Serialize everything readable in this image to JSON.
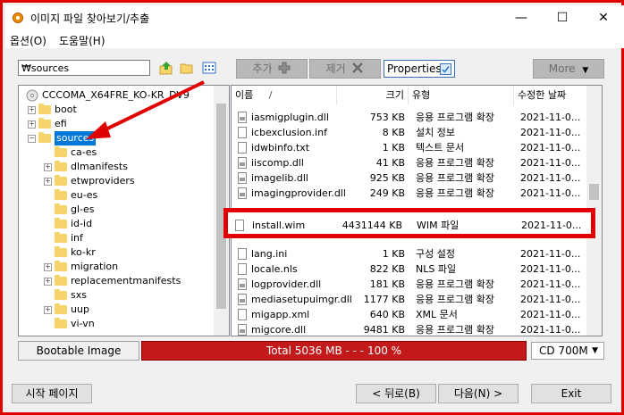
{
  "window": {
    "title": "이미지 파일 찾아보기/추출",
    "controls": {
      "minimize": "—",
      "maximize": "☐",
      "close": "✕"
    }
  },
  "menu": [
    "옵션(O)",
    "도움말(H)"
  ],
  "toolbar": {
    "path": "₩sources",
    "add_label": "추가",
    "remove_label": "제거",
    "properties_label": "Properties",
    "more_label": "More"
  },
  "tree": {
    "root": "CCCOMA_X64FRE_KO-KR_DV9",
    "items": [
      {
        "label": "boot",
        "expandable": true,
        "selected": false
      },
      {
        "label": "efi",
        "expandable": true,
        "selected": false
      },
      {
        "label": "sources",
        "expandable": true,
        "selected": true,
        "expanded": true
      }
    ],
    "children": [
      {
        "label": "ca-es",
        "expandable": false
      },
      {
        "label": "dlmanifests",
        "expandable": true
      },
      {
        "label": "etwproviders",
        "expandable": true
      },
      {
        "label": "eu-es",
        "expandable": false
      },
      {
        "label": "gl-es",
        "expandable": false
      },
      {
        "label": "id-id",
        "expandable": false
      },
      {
        "label": "inf",
        "expandable": false
      },
      {
        "label": "ko-kr",
        "expandable": false
      },
      {
        "label": "migration",
        "expandable": true
      },
      {
        "label": "replacementmanifests",
        "expandable": true
      },
      {
        "label": "sxs",
        "expandable": false
      },
      {
        "label": "uup",
        "expandable": true
      },
      {
        "label": "vi-vn",
        "expandable": false
      }
    ]
  },
  "list": {
    "columns": {
      "name": "이름",
      "sort_marker": "/",
      "size": "크기",
      "type": "유형",
      "date": "수정한 날짜"
    },
    "rows_before": [
      {
        "name": "iasmigplugin.dll",
        "size": "753 KB",
        "type": "응용 프로그램 확장",
        "date": "2021-11-0...",
        "icon": "dll"
      },
      {
        "name": "icbexclusion.inf",
        "size": "8 KB",
        "type": "설치 정보",
        "date": "2021-11-0...",
        "icon": "inf"
      },
      {
        "name": "idwbinfo.txt",
        "size": "1 KB",
        "type": "텍스트 문서",
        "date": "2021-11-0...",
        "icon": "file"
      },
      {
        "name": "iiscomp.dll",
        "size": "41 KB",
        "type": "응용 프로그램 확장",
        "date": "2021-11-0...",
        "icon": "dll"
      },
      {
        "name": "imagelib.dll",
        "size": "925 KB",
        "type": "응용 프로그램 확장",
        "date": "2021-11-0...",
        "icon": "dll"
      },
      {
        "name": "imagingprovider.dll",
        "size": "249 KB",
        "type": "응용 프로그램 확장",
        "date": "2021-11-0...",
        "icon": "dll"
      }
    ],
    "highlighted": {
      "name": "install.wim",
      "size": "4431144 KB",
      "type": "WIM 파일",
      "date": "2021-11-0..."
    },
    "rows_after": [
      {
        "name": "lang.ini",
        "size": "1 KB",
        "type": "구성 설정",
        "date": "2021-11-0...",
        "icon": "inf"
      },
      {
        "name": "locale.nls",
        "size": "822 KB",
        "type": "NLS 파일",
        "date": "2021-11-0...",
        "icon": "file"
      },
      {
        "name": "logprovider.dll",
        "size": "181 KB",
        "type": "응용 프로그램 확장",
        "date": "2021-11-0...",
        "icon": "dll"
      },
      {
        "name": "mediasetupuimgr.dll",
        "size": "1177 KB",
        "type": "응용 프로그램 확장",
        "date": "2021-11-0...",
        "icon": "dll"
      },
      {
        "name": "migapp.xml",
        "size": "640 KB",
        "type": "XML 문서",
        "date": "2021-11-0...",
        "icon": "file"
      },
      {
        "name": "migcore.dll",
        "size": "9481 KB",
        "type": "응용 프로그램 확장",
        "date": "2021-11-0...",
        "icon": "dll"
      }
    ]
  },
  "status": {
    "bootable_label": "Bootable Image",
    "progress_text": "Total  5036 MB   - - -  100 %",
    "progress_percent": 100,
    "media": "CD 700M"
  },
  "footer": {
    "start_page": "시작 페이지",
    "back": "< 뒤로(B)",
    "next": "다음(N) >",
    "exit": "Exit"
  },
  "colors": {
    "highlight": "#e00000",
    "progress": "#b00d0d",
    "selection": "#0078d7"
  }
}
